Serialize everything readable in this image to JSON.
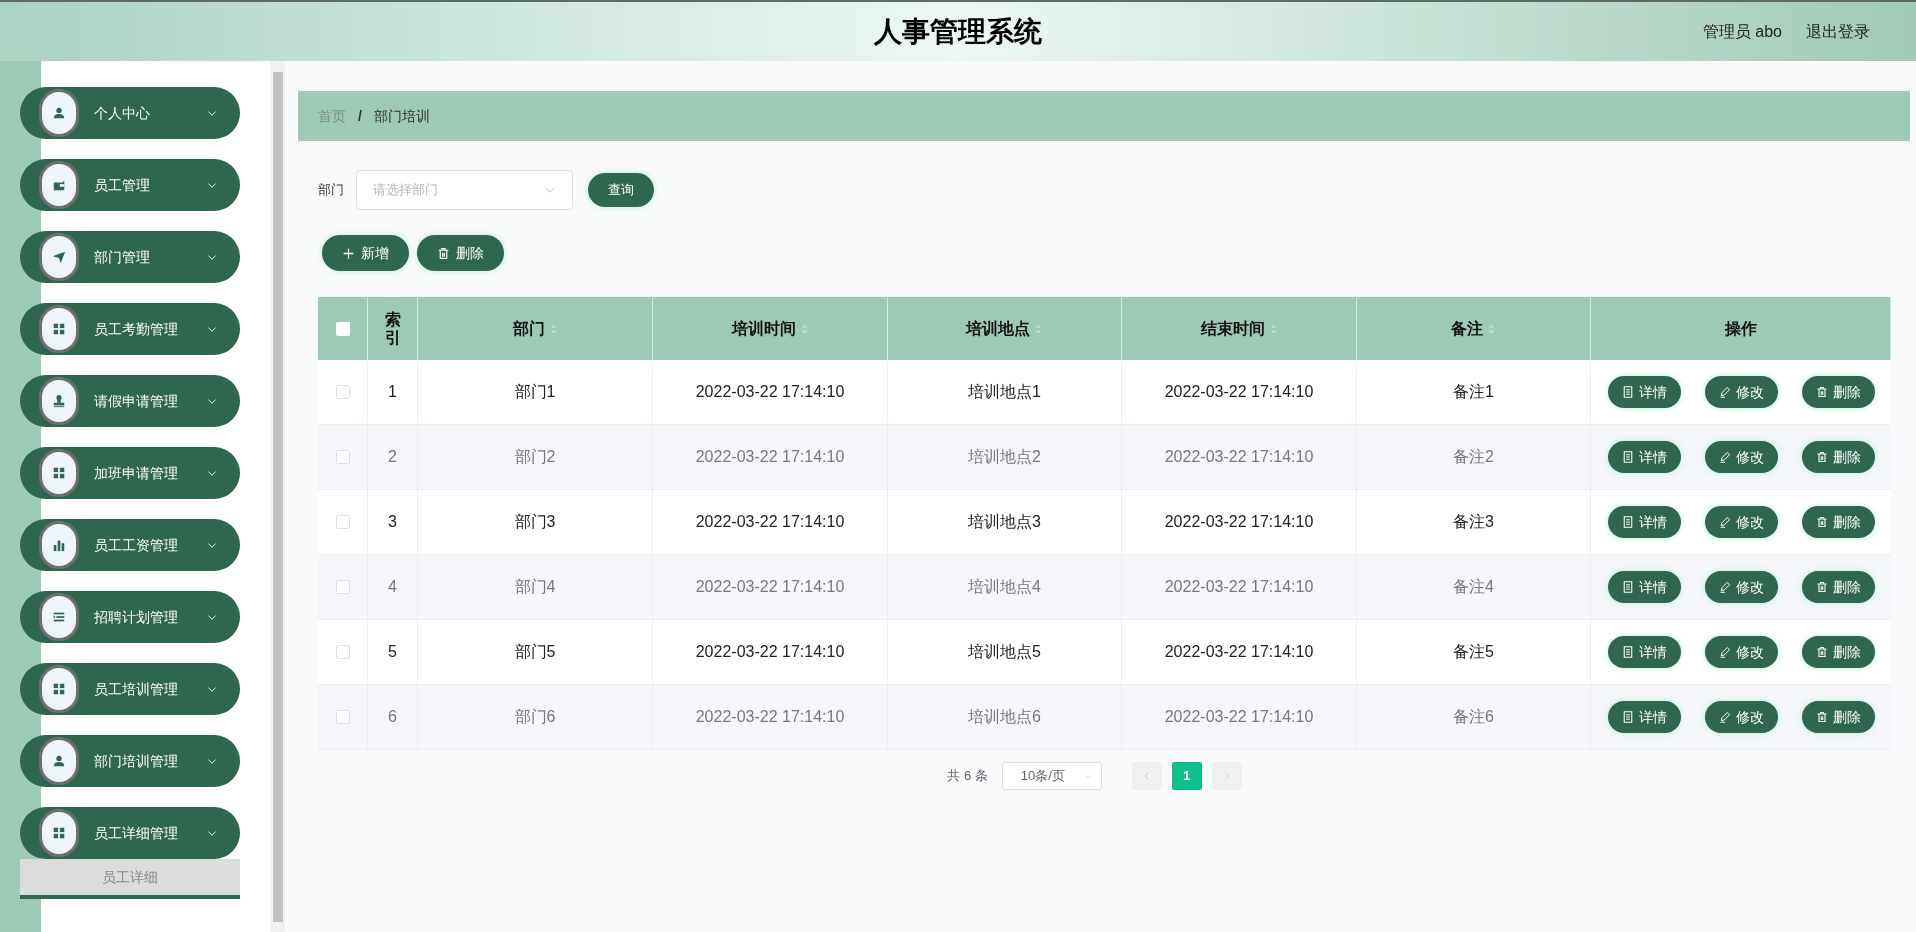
{
  "header": {
    "title": "人事管理系统",
    "user": "管理员 abo",
    "logout": "退出登录"
  },
  "sidebar": {
    "items": [
      {
        "label": "个人中心",
        "kind": "user"
      },
      {
        "label": "员工管理",
        "kind": "wallet"
      },
      {
        "label": "部门管理",
        "kind": "plane"
      },
      {
        "label": "员工考勤管理",
        "kind": "grid"
      },
      {
        "label": "请假申请管理",
        "kind": "stamp"
      },
      {
        "label": "加班申请管理",
        "kind": "grid"
      },
      {
        "label": "员工工资管理",
        "kind": "chart"
      },
      {
        "label": "招聘计划管理",
        "kind": "list"
      },
      {
        "label": "员工培训管理",
        "kind": "grid"
      },
      {
        "label": "部门培训管理",
        "kind": "user"
      },
      {
        "label": "员工详细管理",
        "kind": "grid",
        "children": [
          {
            "label": "员工详细"
          }
        ]
      }
    ]
  },
  "breadcrumb": {
    "items": [
      "首页",
      "部门培训"
    ],
    "separator": "/"
  },
  "filter": {
    "label": "部门",
    "placeholder": "请选择部门",
    "search_button": "查询"
  },
  "toolbar": [
    {
      "label": "新增",
      "kind": "add"
    },
    {
      "label": "删除",
      "kind": "delete"
    }
  ],
  "table": {
    "header_checked": false,
    "columns": [
      {
        "label": "索引",
        "sortable": false
      },
      {
        "label": "部门",
        "sortable": true
      },
      {
        "label": "培训时间",
        "sortable": true
      },
      {
        "label": "培训地点",
        "sortable": true
      },
      {
        "label": "结束时间",
        "sortable": true
      },
      {
        "label": "备注",
        "sortable": true
      },
      {
        "label": "操作",
        "sortable": false
      }
    ],
    "rows": [
      {
        "checked": false,
        "cells": [
          "1",
          "部门1",
          "2022-03-22 17:14:10",
          "培训地点1",
          "2022-03-22 17:14:10",
          "备注1"
        ],
        "actions": [
          "详情",
          "修改",
          "删除"
        ]
      },
      {
        "checked": false,
        "cells": [
          "2",
          "部门2",
          "2022-03-22 17:14:10",
          "培训地点2",
          "2022-03-22 17:14:10",
          "备注2"
        ],
        "actions": [
          "详情",
          "修改",
          "删除"
        ]
      },
      {
        "checked": false,
        "cells": [
          "3",
          "部门3",
          "2022-03-22 17:14:10",
          "培训地点3",
          "2022-03-22 17:14:10",
          "备注3"
        ],
        "actions": [
          "详情",
          "修改",
          "删除"
        ]
      },
      {
        "checked": false,
        "cells": [
          "4",
          "部门4",
          "2022-03-22 17:14:10",
          "培训地点4",
          "2022-03-22 17:14:10",
          "备注4"
        ],
        "actions": [
          "详情",
          "修改",
          "删除"
        ]
      },
      {
        "checked": false,
        "cells": [
          "5",
          "部门5",
          "2022-03-22 17:14:10",
          "培训地点5",
          "2022-03-22 17:14:10",
          "备注5"
        ],
        "actions": [
          "详情",
          "修改",
          "删除"
        ]
      },
      {
        "checked": false,
        "cells": [
          "6",
          "部门6",
          "2022-03-22 17:14:10",
          "培训地点6",
          "2022-03-22 17:14:10",
          "备注6"
        ],
        "actions": [
          "详情",
          "修改",
          "删除"
        ]
      }
    ]
  },
  "pagination": {
    "total": "共 6 条",
    "page_size": "10条/页",
    "pages": [
      {
        "label": "1",
        "selected": true
      }
    ]
  }
}
